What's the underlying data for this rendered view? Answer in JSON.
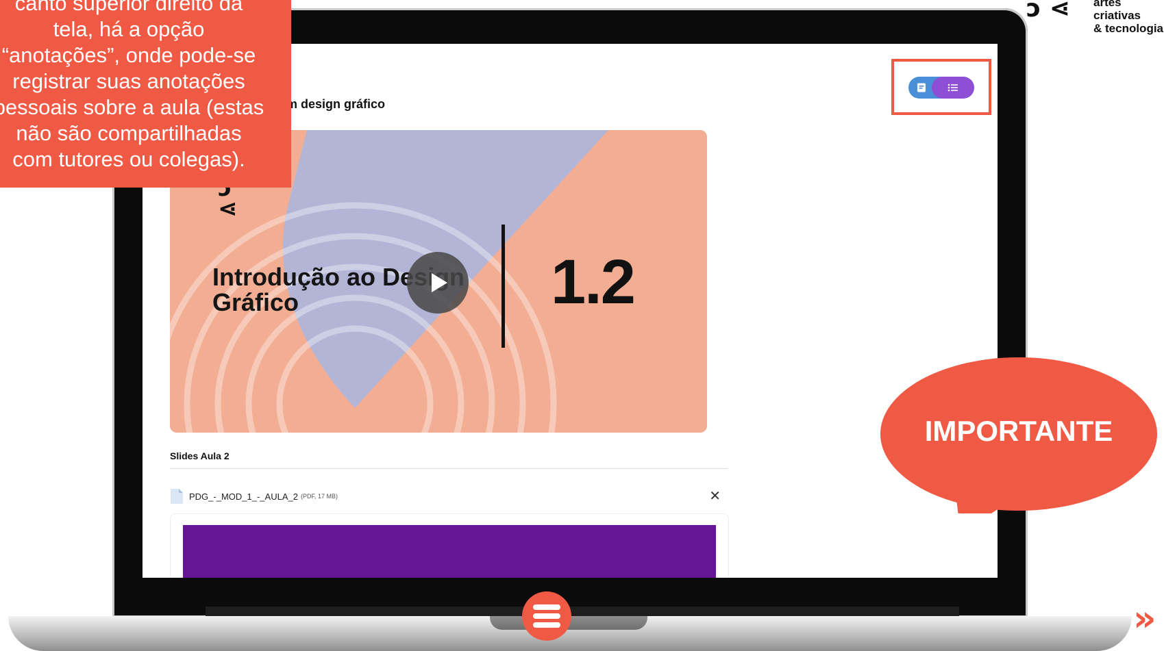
{
  "annotation": {
    "text_lines": [
      "canto superior direito da",
      "tela, há a opção",
      "“anotações”, onde pode-se",
      "registrar suas anotações",
      "pessoais sobre a aula (estas",
      "não são compartilhadas",
      "com tutores ou colegas)."
    ]
  },
  "brand": {
    "mark": "ↄ ⋖",
    "line1": "artes criativas",
    "line2": "& tecnologia"
  },
  "screen": {
    "course_title": "m design gráfico",
    "toggle": {
      "notes_icon": "notes-icon",
      "list_icon": "list-icon",
      "left_color": "#4a90d9",
      "right_color": "#8e4fd6"
    },
    "video": {
      "title_line1": "Introdução ao Design",
      "title_line2": "Gráfico",
      "number": "1.2",
      "logo": "ↄ\n⋖"
    },
    "slides": {
      "heading": "Slides Aula 2",
      "file_name": "PDG_-_MOD_1_-_AULA_2",
      "file_meta": "(PDF, 17 MB)",
      "close_label": "✕",
      "preview_color": "#651596"
    }
  },
  "bubble": {
    "text": "IMPORTANTE",
    "color": "#f05a45"
  },
  "nav": {
    "next_label": "»"
  }
}
